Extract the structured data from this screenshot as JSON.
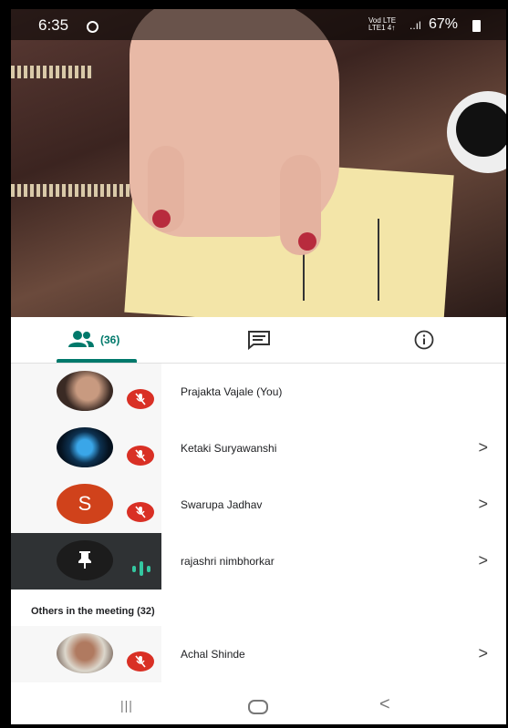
{
  "status_bar": {
    "time": "6:35",
    "network": "Vod LTE\nLTE1 4↑",
    "signal": "..ıl",
    "battery": "67%"
  },
  "tabs": {
    "people_count": "(36)"
  },
  "participants": [
    {
      "name": "Prajakta Vajale (You)",
      "avatar": "photo",
      "muted": true,
      "chevron": ""
    },
    {
      "name": "Ketaki Suryawanshi",
      "avatar": "photo",
      "muted": true,
      "chevron": ">"
    },
    {
      "name": "Swarupa Jadhav",
      "avatar_letter": "S",
      "muted": true,
      "chevron": ">"
    },
    {
      "name": "rajashri nimbhorkar",
      "avatar": "photo",
      "speaking": true,
      "pinned": true,
      "chevron": ">"
    }
  ],
  "others_heading": "Others in the meeting (32)",
  "others": [
    {
      "name": "Achal Shinde",
      "avatar": "photo",
      "muted": true,
      "chevron": ">"
    }
  ],
  "nav": {
    "recents": "|||",
    "back": "<"
  },
  "colors": {
    "accent": "#00796b",
    "muted": "#d93025",
    "avatar_s": "#d0421b"
  }
}
